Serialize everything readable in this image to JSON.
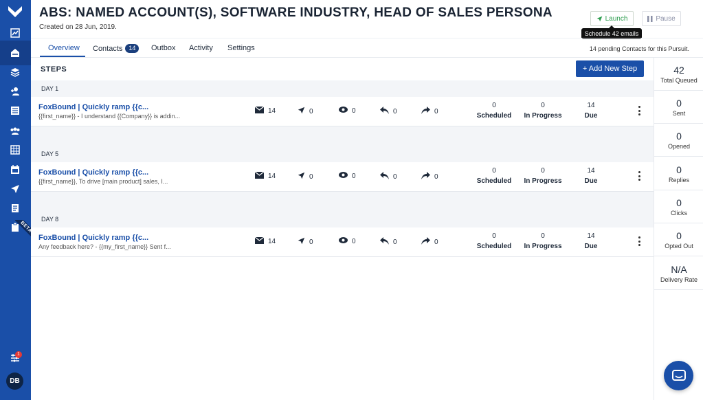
{
  "header": {
    "title": "ABS: NAMED ACCOUNT(S), SOFTWARE INDUSTRY, HEAD OF SALES PERSONA",
    "created": "Created on 28 Jun, 2019.",
    "launch_label": "Launch",
    "pause_label": "Pause",
    "tooltip": "Schedule 42 emails"
  },
  "tabs": [
    {
      "label": "Overview",
      "active": true
    },
    {
      "label": "Contacts",
      "count": "14"
    },
    {
      "label": "Outbox"
    },
    {
      "label": "Activity"
    },
    {
      "label": "Settings"
    }
  ],
  "pending_text": "14 pending Contacts for this Pursuit.",
  "steps_label": "STEPS",
  "add_step_label": "+ Add New Step",
  "stat_labels": {
    "scheduled": "Scheduled",
    "in_progress": "In Progress",
    "due": "Due"
  },
  "steps": [
    {
      "day": "DAY 1",
      "title": "FoxBound | Quickly ramp {{c...",
      "subtitle": "{{first_name}} - I understand {{Company}} is addin...",
      "emails": "14",
      "sent": "0",
      "opened": "0",
      "replies": "0",
      "forwards": "0",
      "scheduled": "0",
      "in_progress": "0",
      "due": "14"
    },
    {
      "day": "DAY 5",
      "title": "FoxBound | Quickly ramp {{c...",
      "subtitle": "{{first_name}},   To drive [main product] sales, I...",
      "emails": "14",
      "sent": "0",
      "opened": "0",
      "replies": "0",
      "forwards": "0",
      "scheduled": "0",
      "in_progress": "0",
      "due": "14"
    },
    {
      "day": "DAY 8",
      "title": "FoxBound | Quickly ramp {{c...",
      "subtitle": "Any feedback here?    - {{my_first_name}}   Sent f...",
      "emails": "14",
      "sent": "0",
      "opened": "0",
      "replies": "0",
      "forwards": "0",
      "scheduled": "0",
      "in_progress": "0",
      "due": "14"
    }
  ],
  "summary": [
    {
      "value": "42",
      "label": "Total Queued"
    },
    {
      "value": "0",
      "label": "Sent"
    },
    {
      "value": "0",
      "label": "Opened"
    },
    {
      "value": "0",
      "label": "Replies"
    },
    {
      "value": "0",
      "label": "Clicks"
    },
    {
      "value": "0",
      "label": "Opted Out"
    },
    {
      "value": "N/A",
      "label": "Delivery Rate"
    }
  ],
  "sidebar": {
    "icons": [
      "logo-icon",
      "analytics-icon",
      "inbox-icon",
      "layers-icon",
      "add-contact-icon",
      "list-icon",
      "team-icon",
      "calendar-grid-icon",
      "calendar-icon",
      "send-icon",
      "document-icon",
      "clipboard-icon"
    ],
    "beta_label": "BETA",
    "notification_count": "1",
    "avatar_initials": "DB"
  },
  "colors": {
    "primary": "#1a4fa8",
    "launch_green": "#2e9e4f",
    "background_band": "#f3f5f8"
  }
}
